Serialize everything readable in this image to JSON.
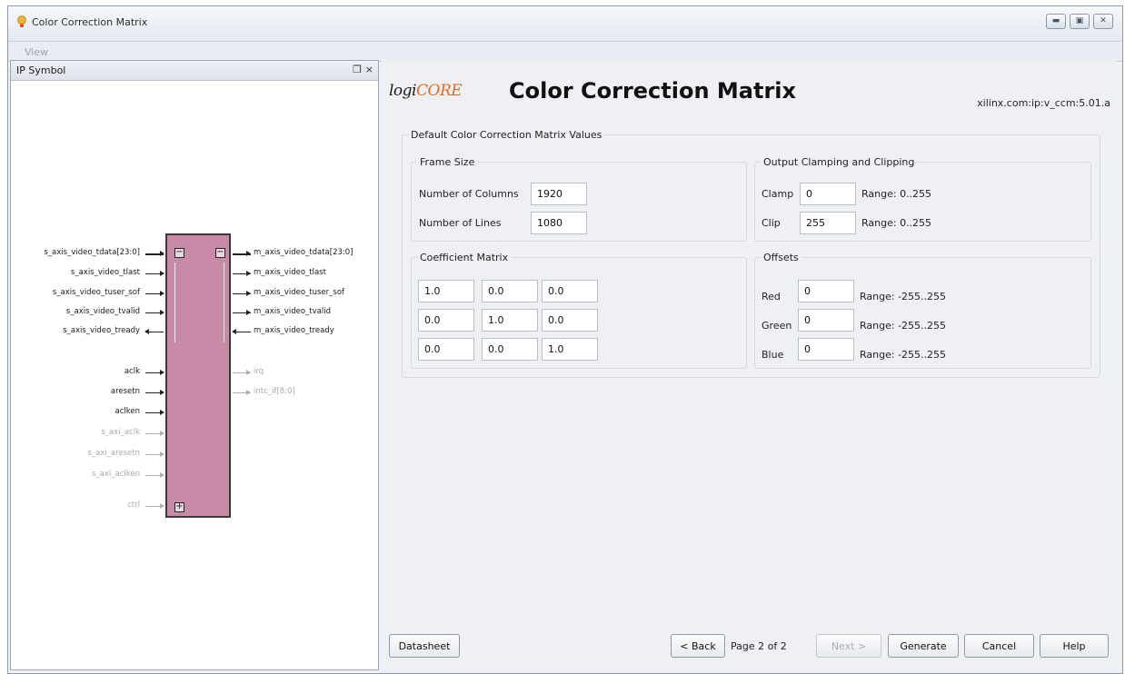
{
  "window": {
    "title": "Color Correction Matrix",
    "menu": {
      "view": "View"
    }
  },
  "ip_symbol": {
    "title": "IP Symbol",
    "controls": {
      "float": "❒",
      "close": "×"
    },
    "left_ports": [
      {
        "name": "s_axis_video_tdata[23:0]",
        "bus": true,
        "dir": "in",
        "dim": false
      },
      {
        "name": "s_axis_video_tlast",
        "dir": "in",
        "dim": false
      },
      {
        "name": "s_axis_video_tuser_sof",
        "dir": "in",
        "dim": false
      },
      {
        "name": "s_axis_video_tvalid",
        "dir": "in",
        "dim": false
      },
      {
        "name": "s_axis_video_tready",
        "dir": "out",
        "dim": false
      },
      {
        "name": "aclk",
        "dir": "in",
        "dim": false
      },
      {
        "name": "aresetn",
        "dir": "in",
        "dim": false
      },
      {
        "name": "aclken",
        "dir": "in",
        "dim": false
      },
      {
        "name": "s_axi_aclk",
        "dir": "in",
        "dim": true
      },
      {
        "name": "s_axi_aresetn",
        "dir": "in",
        "dim": true
      },
      {
        "name": "s_axi_aclken",
        "dir": "in",
        "dim": true
      },
      {
        "name": "ctrl",
        "dir": "bi",
        "dim": true
      }
    ],
    "right_ports": [
      {
        "name": "m_axis_video_tdata[23:0]",
        "bus": true,
        "dir": "out",
        "dim": false
      },
      {
        "name": "m_axis_video_tlast",
        "dir": "out",
        "dim": false
      },
      {
        "name": "m_axis_video_tuser_sof",
        "dir": "out",
        "dim": false
      },
      {
        "name": "m_axis_video_tvalid",
        "dir": "out",
        "dim": false
      },
      {
        "name": "m_axis_video_tready",
        "dir": "in",
        "dim": false
      },
      {
        "name": "irq",
        "dir": "out",
        "dim": true
      },
      {
        "name": "intc_if[8:0]",
        "dir": "out",
        "dim": true
      }
    ]
  },
  "header": {
    "logo_prefix": "logi",
    "logo_core": "CORE",
    "title": "Color Correction Matrix",
    "vlnv": "xilinx.com:ip:v_ccm:5.01.a"
  },
  "defaults_group": {
    "legend": "Default Color Correction Matrix Values",
    "frame_size": {
      "legend": "Frame Size",
      "columns_label": "Number of Columns",
      "columns_value": "1920",
      "lines_label": "Number of Lines",
      "lines_value": "1080"
    },
    "clamping": {
      "legend": "Output Clamping and Clipping",
      "clamp_label": "Clamp",
      "clamp_value": "0",
      "clamp_range": "Range: 0..255",
      "clip_label": "Clip",
      "clip_value": "255",
      "clip_range": "Range: 0..255"
    },
    "coefficients": {
      "legend": "Coefficient Matrix",
      "rows": [
        [
          "1.0",
          "0.0",
          "0.0"
        ],
        [
          "0.0",
          "1.0",
          "0.0"
        ],
        [
          "0.0",
          "0.0",
          "1.0"
        ]
      ]
    },
    "offsets": {
      "legend": "Offsets",
      "red_label": "Red",
      "red_value": "0",
      "red_range": "Range: -255..255",
      "green_label": "Green",
      "green_value": "0",
      "green_range": "Range: -255..255",
      "blue_label": "Blue",
      "blue_value": "0",
      "blue_range": "Range: -255..255"
    }
  },
  "footer": {
    "datasheet": "Datasheet",
    "back": "< Back",
    "page": "Page 2 of 2",
    "next": "Next >",
    "generate": "Generate",
    "cancel": "Cancel",
    "help": "Help"
  }
}
